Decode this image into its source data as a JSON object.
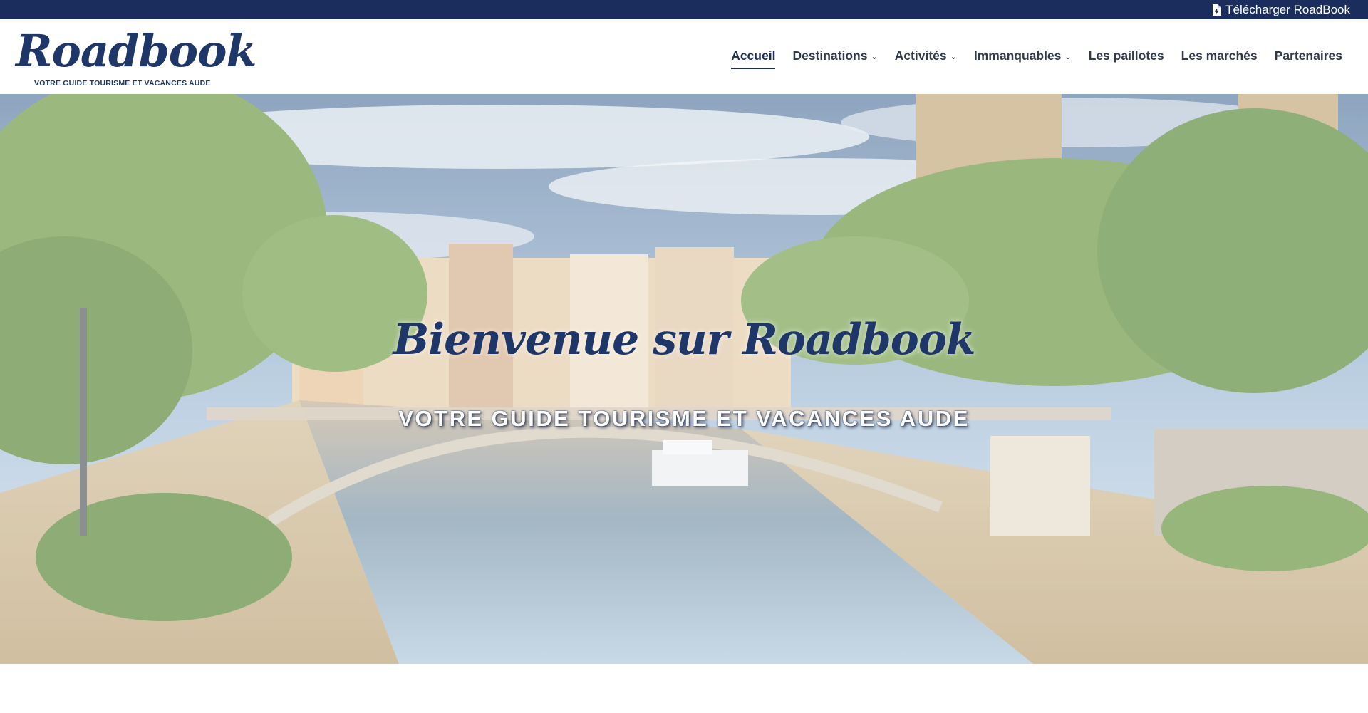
{
  "topbar": {
    "download_label": "Télécharger RoadBook",
    "download_icon": "file-download-icon",
    "background": "#1b2d5d"
  },
  "logo": {
    "wordmark": "Roadbook",
    "tagline": "VOTRE GUIDE TOURISME ET VACANCES AUDE"
  },
  "nav": {
    "items": [
      {
        "label": "Accueil",
        "active": true,
        "has_dropdown": false
      },
      {
        "label": "Destinations",
        "active": false,
        "has_dropdown": true
      },
      {
        "label": "Activités",
        "active": false,
        "has_dropdown": true
      },
      {
        "label": "Immanquables",
        "active": false,
        "has_dropdown": true
      },
      {
        "label": "Les paillotes",
        "active": false,
        "has_dropdown": false
      },
      {
        "label": "Les marchés",
        "active": false,
        "has_dropdown": false
      },
      {
        "label": "Partenaires",
        "active": false,
        "has_dropdown": false
      }
    ],
    "dropdown_icon": "chevron-down-icon"
  },
  "hero": {
    "title": "Bienvenue sur Roadbook",
    "subtitle": "VOTRE GUIDE TOURISME ET VACANCES AUDE",
    "image": "canal-narbonne-photo",
    "accent": "#1f3668"
  }
}
